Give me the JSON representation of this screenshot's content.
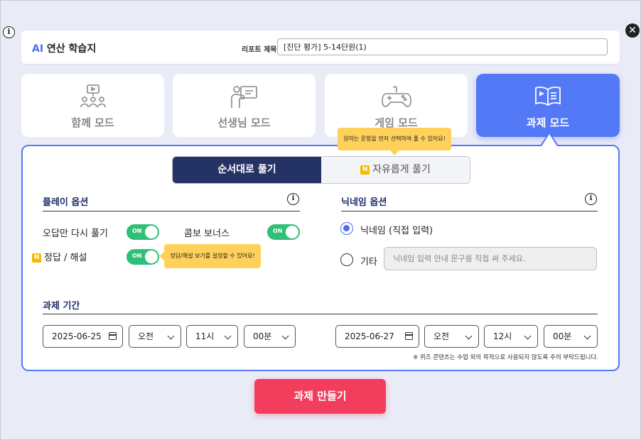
{
  "header": {
    "app_title_ai": "AI",
    "app_title_rest": " 연산 학습지",
    "report_label": "리포트 제목",
    "report_value": "[진단 평가] 5-14단원(1)"
  },
  "modes": [
    {
      "label": "함께 모드",
      "icon": "group-presentation-icon"
    },
    {
      "label": "선생님 모드",
      "icon": "teacher-board-icon"
    },
    {
      "label": "게임 모드",
      "icon": "gamepad-icon"
    },
    {
      "label": "과제 모드",
      "icon": "open-book-icon"
    }
  ],
  "tooltips": {
    "order": "원하는 문항을 먼저 선택하여 풀 수 있어요!",
    "answer": "정답/해설 보기를 설정할 수 있어요!"
  },
  "seg": {
    "order": "순서대로 풀기",
    "free": "자유롭게 풀기",
    "badge": "N"
  },
  "play": {
    "title": "플레이 옵션",
    "wrong_only": "오답만 다시 풀기",
    "combo": "콤보 보너스",
    "answer": "정답 / 해설",
    "badge": "N",
    "toggle_text": "ON"
  },
  "nick": {
    "title": "닉네임 옵션",
    "option1": "닉네임 (직접 입력)",
    "option2": "기타",
    "placeholder": "닉네임 입력 안내 문구를 직접 써 주세요."
  },
  "period": {
    "title": "과제 기간",
    "start": {
      "date": "2025-06-25",
      "ampm": "오전",
      "hour": "11시",
      "minute": "00분"
    },
    "end": {
      "date": "2025-06-27",
      "ampm": "오전",
      "hour": "12시",
      "minute": "00분"
    },
    "note": "※ 퀴즈 콘텐츠는 수업 외의 목적으로 사용되지 않도록 주의 부탁드립니다."
  },
  "create_label": "과제 만들기",
  "colors": {
    "accent": "#5479f7",
    "navy": "#243364",
    "toggle": "#2fbf78",
    "cta": "#f23e5c",
    "tooltip": "#ffd05a"
  }
}
